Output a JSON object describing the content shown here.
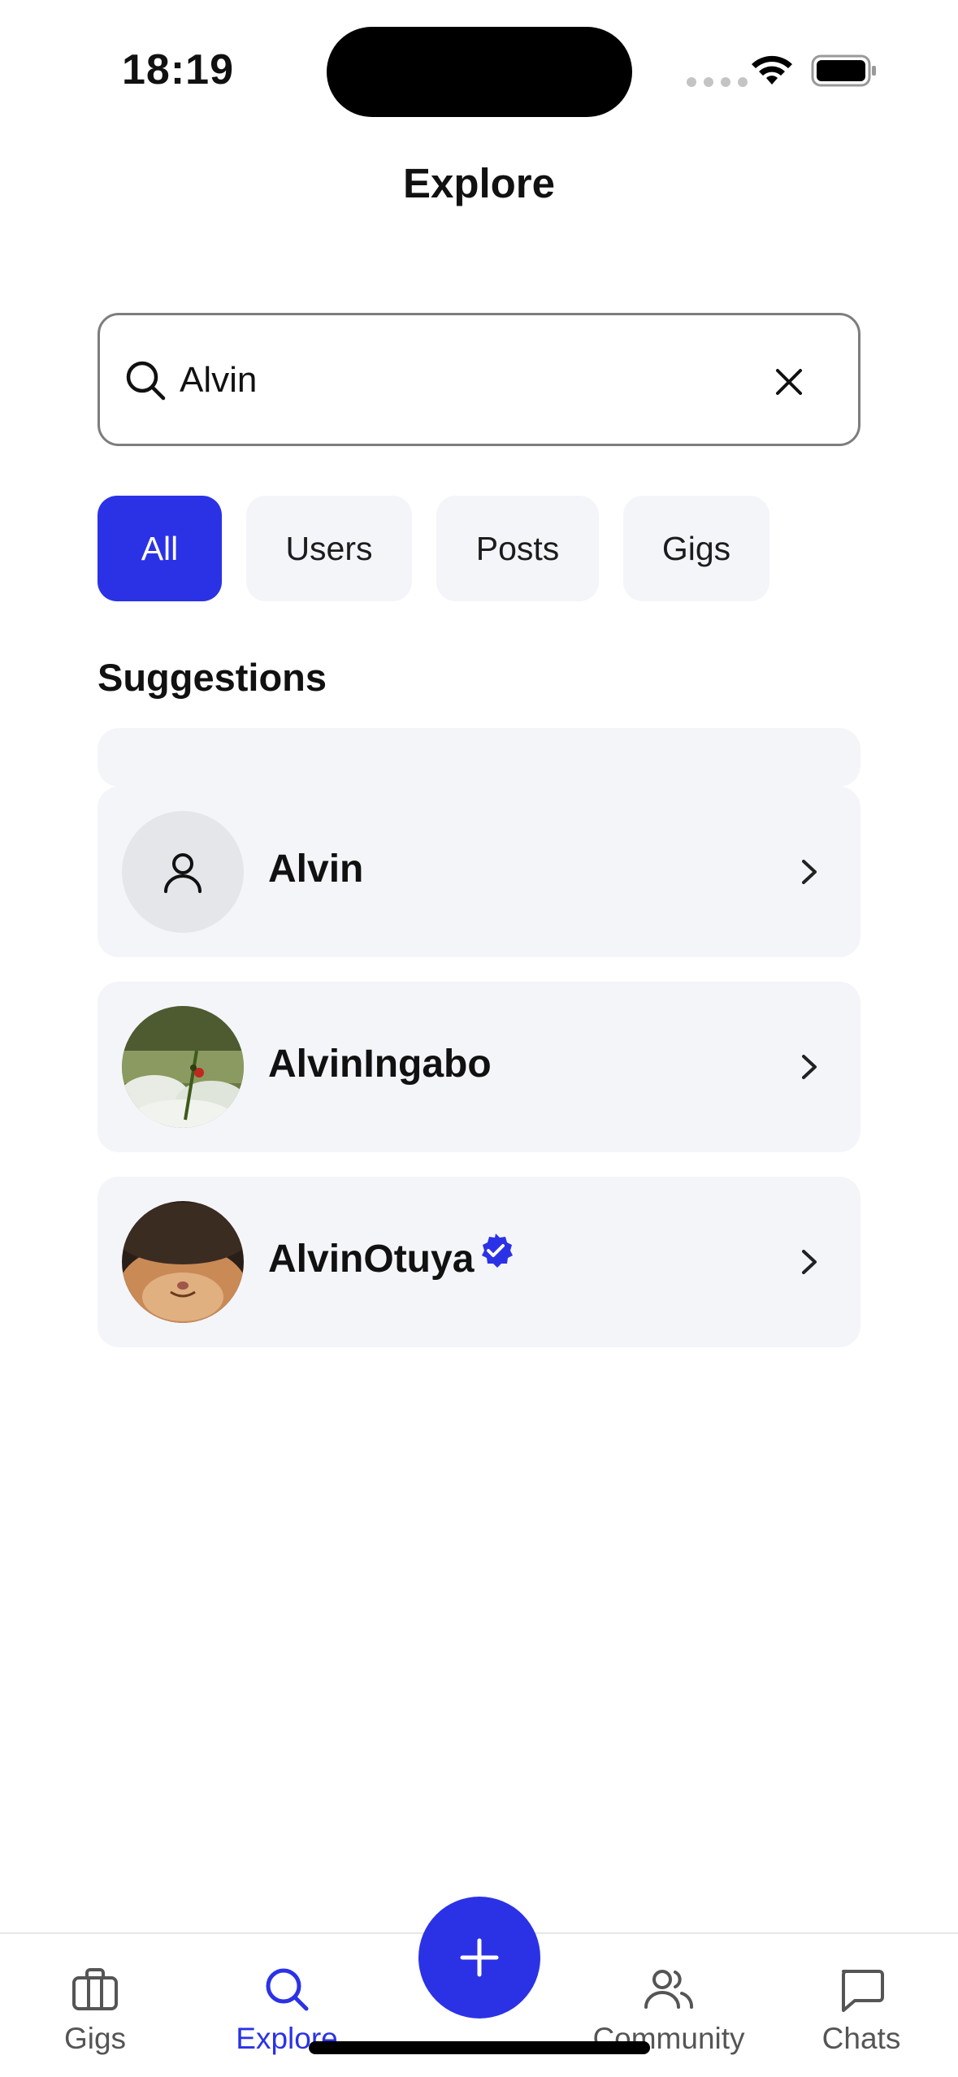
{
  "status_bar": {
    "time": "18:19"
  },
  "header": {
    "title": "Explore"
  },
  "search": {
    "value": "Alvin",
    "clear_icon": "close-icon",
    "search_icon": "search-icon"
  },
  "filters": [
    {
      "label": "All",
      "active": true
    },
    {
      "label": "Users",
      "active": false
    },
    {
      "label": "Posts",
      "active": false
    },
    {
      "label": "Gigs",
      "active": false
    }
  ],
  "suggestions": {
    "title": "Suggestions",
    "items": [
      {
        "name": "Alvin",
        "avatar": "default-user-icon",
        "verified": false
      },
      {
        "name": "AlvinIngabo",
        "avatar": "photo-flower-field",
        "verified": false
      },
      {
        "name": "AlvinOtuya",
        "avatar": "photo-cat",
        "verified": true
      }
    ]
  },
  "tab_bar": {
    "items": [
      {
        "label": "Gigs",
        "icon": "briefcase-icon",
        "active": false
      },
      {
        "label": "Explore",
        "icon": "search-icon",
        "active": true
      },
      {
        "label": "Community",
        "icon": "users-icon",
        "active": false
      },
      {
        "label": "Chats",
        "icon": "chat-icon",
        "active": false
      }
    ],
    "fab_icon": "plus-icon"
  },
  "colors": {
    "accent": "#2b32e6",
    "card": "#f4f5f9"
  }
}
